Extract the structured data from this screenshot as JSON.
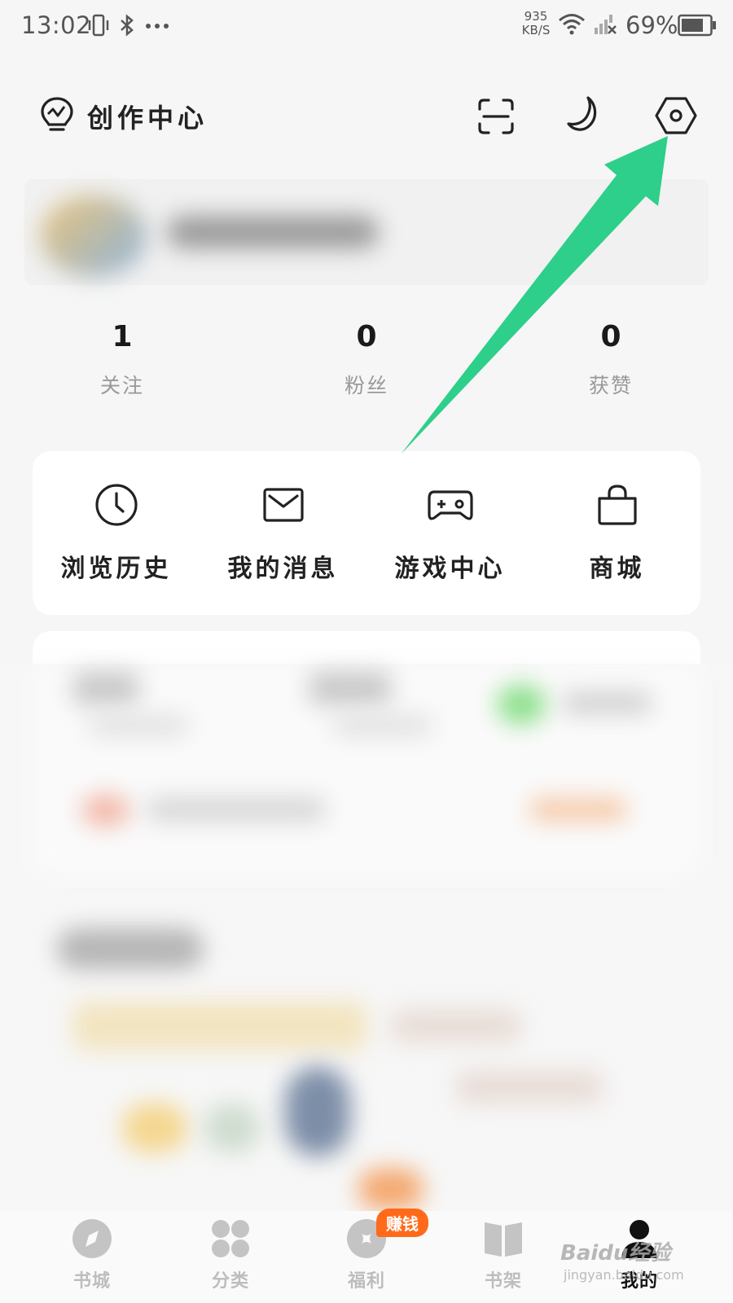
{
  "status_bar": {
    "time": "13:02",
    "net_speed_value": "935",
    "net_speed_unit": "KB/S",
    "battery": "69%",
    "icons": [
      "vibrate-icon",
      "bluetooth-icon",
      "more-dots-icon",
      "wifi-icon",
      "signal-off-icon",
      "battery-icon"
    ]
  },
  "header": {
    "title": "创作中心",
    "icons": [
      "bulb-icon",
      "scan-icon",
      "night-mode-icon",
      "settings-icon"
    ]
  },
  "stats": [
    {
      "value": "1",
      "label": "关注"
    },
    {
      "value": "0",
      "label": "粉丝"
    },
    {
      "value": "0",
      "label": "获赞"
    }
  ],
  "quick_actions": [
    {
      "label": "浏览历史",
      "icon": "clock-icon"
    },
    {
      "label": "我的消息",
      "icon": "mail-icon"
    },
    {
      "label": "游戏中心",
      "icon": "gamepad-icon"
    },
    {
      "label": "商城",
      "icon": "shopping-bag-icon"
    }
  ],
  "bottom_nav": {
    "items": [
      {
        "label": "书城",
        "icon": "compass-icon"
      },
      {
        "label": "分类",
        "icon": "grid-icon"
      },
      {
        "label": "福利",
        "icon": "welfare-icon",
        "badge": "赚钱"
      },
      {
        "label": "书架",
        "icon": "book-icon"
      },
      {
        "label": "我的",
        "icon": "user-icon",
        "active": true
      }
    ]
  },
  "watermark": {
    "main": "Baidu经验",
    "sub": "jingyan.baidu.com"
  },
  "colors": {
    "accent_arrow": "#2ecf8a",
    "badge": "#ff6a1a",
    "background": "#f6f6f6"
  }
}
